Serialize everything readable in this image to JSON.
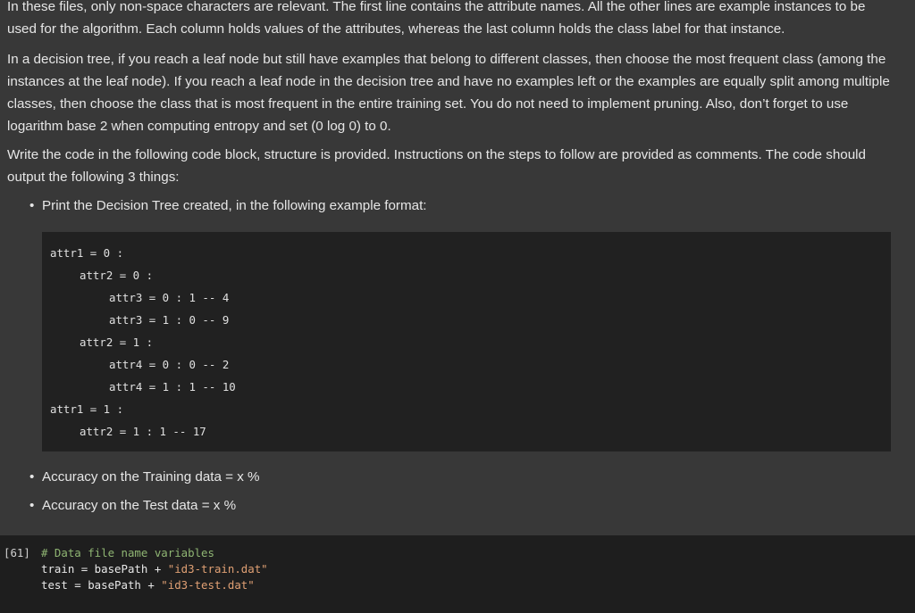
{
  "markdown": {
    "p1": "In these files, only non-space characters are relevant. The first line contains the attribute names. All the other lines are example instances to be used for the algorithm. Each column holds values of the attributes, whereas the last column holds the class label for that instance.",
    "p2": "In a decision tree, if you reach a leaf node but still have examples that belong to different classes, then choose the most frequent class (among the instances at the leaf node). If you reach a leaf node in the decision tree and have no examples left or the examples are equally split among multiple classes, then choose the class that is most frequent in the entire training set. You do not need to implement pruning. Also, don’t forget to use logarithm base 2 when computing entropy and set (0 log 0) to 0.",
    "p3": "Write the code in the following code block, structure is provided. Instructions on the steps to follow are provided as comments. The code should output the following 3 things:",
    "bullet_dot": "•",
    "bullet1": "Print the Decision Tree created, in the following example format:",
    "bullet2": "Accuracy on the Training data = x %",
    "bullet3": "Accuracy on the Test data = x %"
  },
  "tree_example": [
    "attr1 = 0 :",
    "attr2 = 0 :",
    "attr3 = 0 : 1 -- 4",
    "attr3 = 1 : 0 -- 9",
    "attr2 = 1 :",
    "attr4 = 0 : 0 -- 2",
    "attr4 = 1 : 1 -- 10",
    "attr1 = 1 :",
    "attr2 = 1 : 1 -- 17"
  ],
  "code_cell": {
    "execution_count": "[61]",
    "comment": "# Data file name variables",
    "line2_prefix": "train = basePath + ",
    "line2_string": "\"id3-train.dat\"",
    "line3_prefix": "test = basePath + ",
    "line3_string": "\"id3-test.dat\""
  }
}
